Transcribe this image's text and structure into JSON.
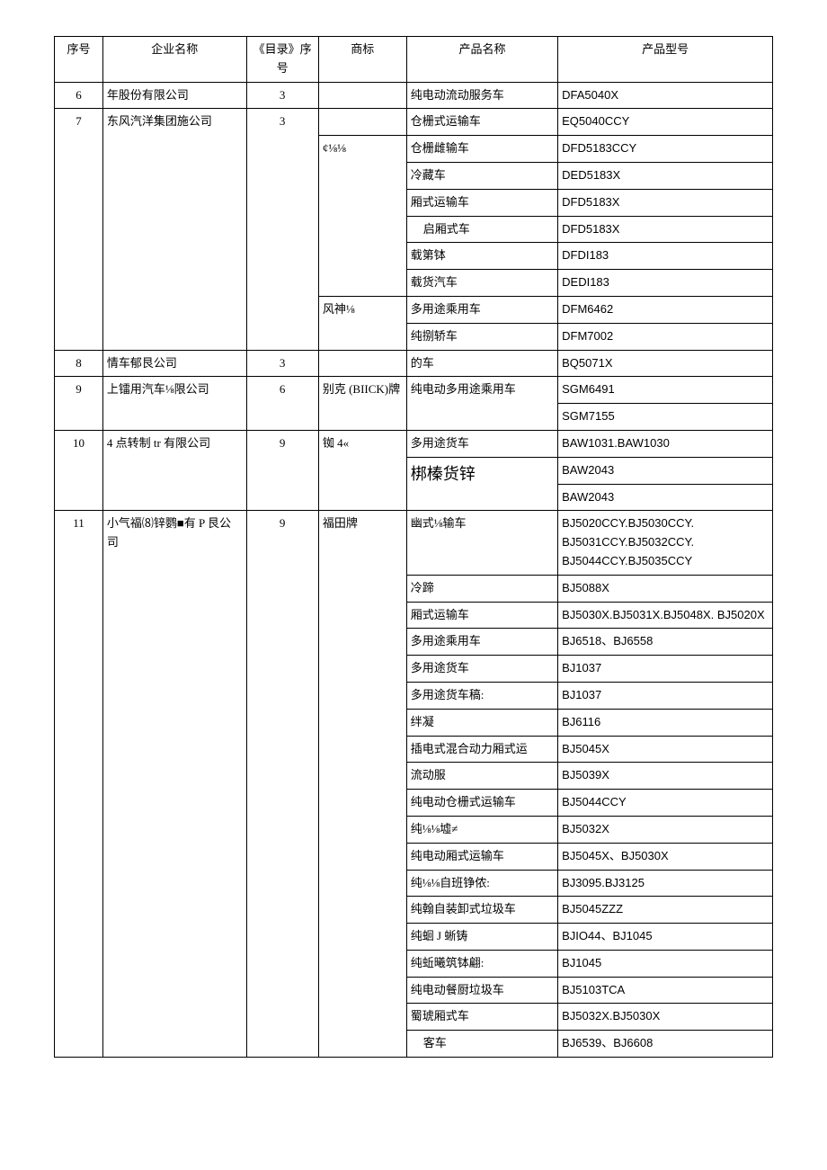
{
  "headers": {
    "seq": "序号",
    "enterprise": "企业名称",
    "catalog": "《目录》序号",
    "brand": "商标",
    "product": "产品名称",
    "model": "产品型号"
  },
  "rows": [
    {
      "seq": "6",
      "ent": "年股份有限公司",
      "cat": "3",
      "brand": "",
      "prod": "纯电动流动服务车",
      "model": "DFA5040X"
    },
    {
      "seq": "7",
      "ent": "东风汽洋集团施公司",
      "cat": "3",
      "brand": "",
      "prod": "仓栅式运输车",
      "model": "EQ5040CCY"
    },
    {
      "brand": "¢⅛⅛",
      "prod": "仓栅雌输车",
      "model": "DFD5183CCY"
    },
    {
      "prod": "冷藏车",
      "model": "DED5183X"
    },
    {
      "prod": "厢式运输车",
      "model": "DFD5183X"
    },
    {
      "prod": "启厢式车",
      "model": "DFD5183X",
      "indent": true
    },
    {
      "prod": "载第钵",
      "model": "DFDI183"
    },
    {
      "prod": "载货汽车",
      "model": "DEDI183"
    },
    {
      "brand": "风神⅛",
      "prod": "多用途乘用车",
      "model": "DFM6462"
    },
    {
      "prod": "纯捌轿车",
      "model": "DFM7002"
    },
    {
      "seq": "8",
      "ent": "情车郁艮公司",
      "cat": "3",
      "brand": "",
      "prod": "的车",
      "model": "BQ5071X"
    },
    {
      "seq": "9",
      "ent": "上镭用汽车⅛限公司",
      "cat": "6",
      "brand": "别克 (BIICK)牌",
      "prod": "纯电动多用途乘用车",
      "model": "SGM6491"
    },
    {
      "model": "SGM7155"
    },
    {
      "seq": "10",
      "ent": "4 点转制 tr 有限公司",
      "cat": "9",
      "brand": "铷 4«",
      "prod": "多用途货车",
      "model": "BAW1031.BAW1030"
    },
    {
      "prod": "梆榛货锌",
      "model": "BAW2043",
      "big": true
    },
    {
      "model": "BAW2043"
    },
    {
      "seq": "11",
      "ent": "小气福⑻锌鹦■有 P 艮公司",
      "cat": "9",
      "brand": "福田牌",
      "prod": "幽式⅛输车",
      "model": "BJ5020CCY.BJ5030CCY. BJ5031CCY.BJ5032CCY. BJ5044CCY.BJ5035CCY"
    },
    {
      "prod": "冷蹄",
      "model": "BJ5088X"
    },
    {
      "prod": "厢式运输车",
      "model": "BJ5030X.BJ5031X.BJ5048X. BJ5020X"
    },
    {
      "prod": "多用途乘用车",
      "model": "BJ6518、BJ6558"
    },
    {
      "prod": "多用途货车",
      "model": "BJ1037"
    },
    {
      "prod": "多用途货车稿:",
      "model": "BJ1037"
    },
    {
      "prod": "绊凝",
      "model": "BJ6116"
    },
    {
      "prod": "插电式混合动力厢式运",
      "model": "BJ5045X"
    },
    {
      "prod": "流动服",
      "model": "BJ5039X"
    },
    {
      "prod": "纯电动仓栅式运输车",
      "model": "BJ5044CCY"
    },
    {
      "prod": "纯⅛⅛墟≠",
      "model": "BJ5032X"
    },
    {
      "prod": "纯电动厢式运输车",
      "model": "BJ5045X、BJ5030X"
    },
    {
      "prod": "纯⅛⅛自班铮侬:",
      "model": "BJ3095.BJ3125"
    },
    {
      "prod": "纯翰自装卸式垃圾车",
      "model": "BJ5045ZZZ"
    },
    {
      "prod": "纯蛔 J 蜥铸",
      "model": "BJIO44、BJ1045"
    },
    {
      "prod": "纯蚯曦筑钵翩:",
      "model": "BJ1045"
    },
    {
      "prod": "纯电动餐厨垃圾车",
      "model": "BJ5103TCA"
    },
    {
      "prod": "蜀琥厢式车",
      "model": "BJ5032X.BJ5030X"
    },
    {
      "prod": "客车",
      "model": "BJ6539、BJ6608",
      "indent": true
    }
  ]
}
